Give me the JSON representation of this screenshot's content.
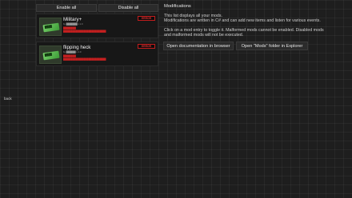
{
  "side_label": "back",
  "toolbar": {
    "enable_all": "Enable all",
    "disable_all": "Disable all"
  },
  "mods": [
    {
      "title": "Military+",
      "subtitle": "by ███████ v 1.0",
      "errors": [
        "████████",
        "███████████████████████████"
      ],
      "badge": "ERROR",
      "thumb_label": "████"
    },
    {
      "title": "flipping heck",
      "subtitle": "by ██████ v 1.0",
      "errors": [
        "████████",
        "███████████████████████████"
      ],
      "badge": "ERROR",
      "thumb_label": "████"
    }
  ],
  "panel": {
    "title": "Modifications",
    "line1": "This list displays all your mods.",
    "line2": "Modifications are written in C# and can add new items and listen for various events.",
    "line3": "Click on a mod entry to toggle it. Malformed mods cannot be enabled. Disabled mods",
    "line4": "and malformed mods will not be executed.",
    "open_docs": "Open documentation in browser",
    "open_folder": "Open \"Mods\" folder in Explorer"
  },
  "colors": {
    "background": "#1e1e1e",
    "error_red": "#c82020",
    "entry_bg": "#171717",
    "button_bg": "#2b2b2b"
  }
}
